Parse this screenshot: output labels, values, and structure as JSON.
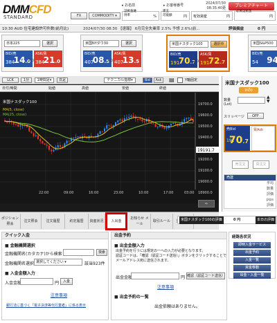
{
  "header": {
    "logo_main": "DMM",
    "logo_accent": "CFD",
    "logo_sub": "STANDARD",
    "name_label": "お名前",
    "account_label": "お客様番号",
    "datetime": "2024/07/30",
    "time": "08:35:40更新",
    "premium_button": "プレミアチャート",
    "fx_button": "FX",
    "commodity_button": "COMMODITY",
    "margin_label": "証拠金維持率",
    "margin_value": "%",
    "net_label": "建玉",
    "net_sub": "可能額",
    "net_value": "円",
    "collateral_label": "有効資産",
    "collateral_value": "円",
    "required_label": "必要証拠金",
    "required_value": "円",
    "pnl_label": "評価損益",
    "pnl_value": "0 円"
  },
  "ticker": {
    "text1": "10:30 AUD 住宅建設許可件数(前月比)",
    "text2": "2024/07/30 08:30 【速報】 6月完全失業率 2.5% 予想 2.6%(前..."
  },
  "panels": [
    {
      "name": "日本225",
      "select": "選択",
      "bid_label": "BID/売",
      "ask_label": "ASK/買",
      "bid_head": "384",
      "bid_big": "14",
      "bid_tail": ".0",
      "ask_head": "384",
      "ask_big": "21",
      "ask_tail": ".0",
      "spread": "7.0"
    },
    {
      "name": "米国NYダウ30",
      "select": "選択",
      "bid_label": "BID/売",
      "ask_label": "ASK/買",
      "bid_head": "407",
      "bid_big": "08",
      "bid_tail": ".5",
      "ask_head": "407",
      "ask_big": "13",
      "ask_tail": ".5",
      "spread": "5.0"
    },
    {
      "name": "米国ナスダック100",
      "select": "選択中",
      "bid_label": "BID/売",
      "ask_label": "ASK/買",
      "bid_head": "191",
      "bid_big": "70",
      "bid_tail": ".7",
      "ask_head": "191",
      "ask_big": "72",
      "ask_tail": ".7",
      "spread": "2.0"
    },
    {
      "name": "米国S&P500",
      "select": "選択",
      "bid_label": "BID/売",
      "ask_label": "",
      "bid_head": "54",
      "bid_big": "94",
      "bid_tail": "",
      "ask_head": "",
      "ask_big": "",
      "ask_tail": "",
      "spread": ""
    }
  ],
  "chart": {
    "toolbar": [
      "LCK",
      "1分",
      "1時間足",
      "日足",
      "テクニカル指標",
      "Bid",
      "Ask"
    ],
    "checkbox_label": "Y軸固定",
    "ohlc_labels": [
      "日付/時間",
      "始値",
      "高値",
      "安値",
      "終値"
    ],
    "symbol": "米国ナスダック100",
    "ma5_label": "MA(5, close)",
    "ma25_label": "MA(25, close)",
    "y_ticks": [
      "19700.0",
      "19600.0",
      "19500.0",
      "19400.0",
      "19300.0",
      "19200.0",
      "19100.0",
      "19000.0",
      "18900.0",
      "18800.0"
    ],
    "x_ticks": [
      "22:00",
      "09:00",
      "16:00",
      "23:00",
      "10:00",
      "17:00",
      "03:00"
    ],
    "current_price": "19191.7",
    "nav_icon": "⇨"
  },
  "bottom_tabs": [
    "ポジション\n照会",
    "注文照会",
    "注文履歴",
    "約定履歴",
    "資産状況",
    "入出金",
    "お知らせ\nメール",
    "取引ルール",
    "重要事項"
  ],
  "right_panel": {
    "symbol": "米国ナスダック100",
    "info_button": "info",
    "qty_label": "数量",
    "qty_unit": "(Lot)",
    "slippage_label": "スリッページ",
    "slippage_value": "OFF",
    "bid_label": "売Bid",
    "ask_label": "買Ask",
    "bid_head": "191",
    "bid_big": "70",
    "bid_tail": ".7",
    "ask_head": "191",
    "ask_big": "72",
    "ask_tail": ".7",
    "bid_btn": "売注文",
    "ask_btn": "買注文",
    "table_head": "売建",
    "table_rows": [
      "平均",
      "数量",
      "評価",
      "pips",
      "評価"
    ],
    "bottom_label": "米国ナスダック100の評価",
    "bottom_value": "0 円",
    "bottom_right": "本日の評価"
  },
  "quick_deposit": {
    "title": "クイック入金",
    "bank_title": "金融機関選択",
    "bank_search_label": "金融機関名(カタカナ)から検索",
    "search_button": "検索",
    "bank_select_label": "金融機関名選択",
    "bank_select_value": "選択してください",
    "bank_count": "該当923件",
    "amount_title": "入金金額入力",
    "amount_label": "入金金額",
    "amount_unit": "円",
    "amount_button": "入金",
    "notes_link": "注意事項",
    "electronic_link": "銀行法に基づく「電子決済等代行業者」に係る表示"
  },
  "withdraw": {
    "title": "出金予約",
    "input_title": "出金金額入力",
    "desc1": "出金予約を行うには規定の一への入力が必要となります。",
    "desc2": "認証コードは、「確認（認証コード送信）」ボタンをクリックすることで",
    "desc3": "メールアドレス宛に送信されます。",
    "amount_label": "出金金額",
    "amount_unit": "円",
    "confirm_button": "確認（認証コード送信）",
    "notes_link": "注意事項",
    "list_title": "出金予約の一覧",
    "empty_text": "出金依頼はありません。"
  },
  "side_menu": {
    "title": "経路各状況",
    "items": [
      "即時入金サービス",
      "出金予約",
      "入金一覧",
      "資金移動",
      "出金・入金一覧"
    ]
  },
  "colors": {
    "bid": "#2a56a8",
    "ask": "#d63a2a",
    "accent": "#e07a00",
    "highlight": "#d10000"
  }
}
